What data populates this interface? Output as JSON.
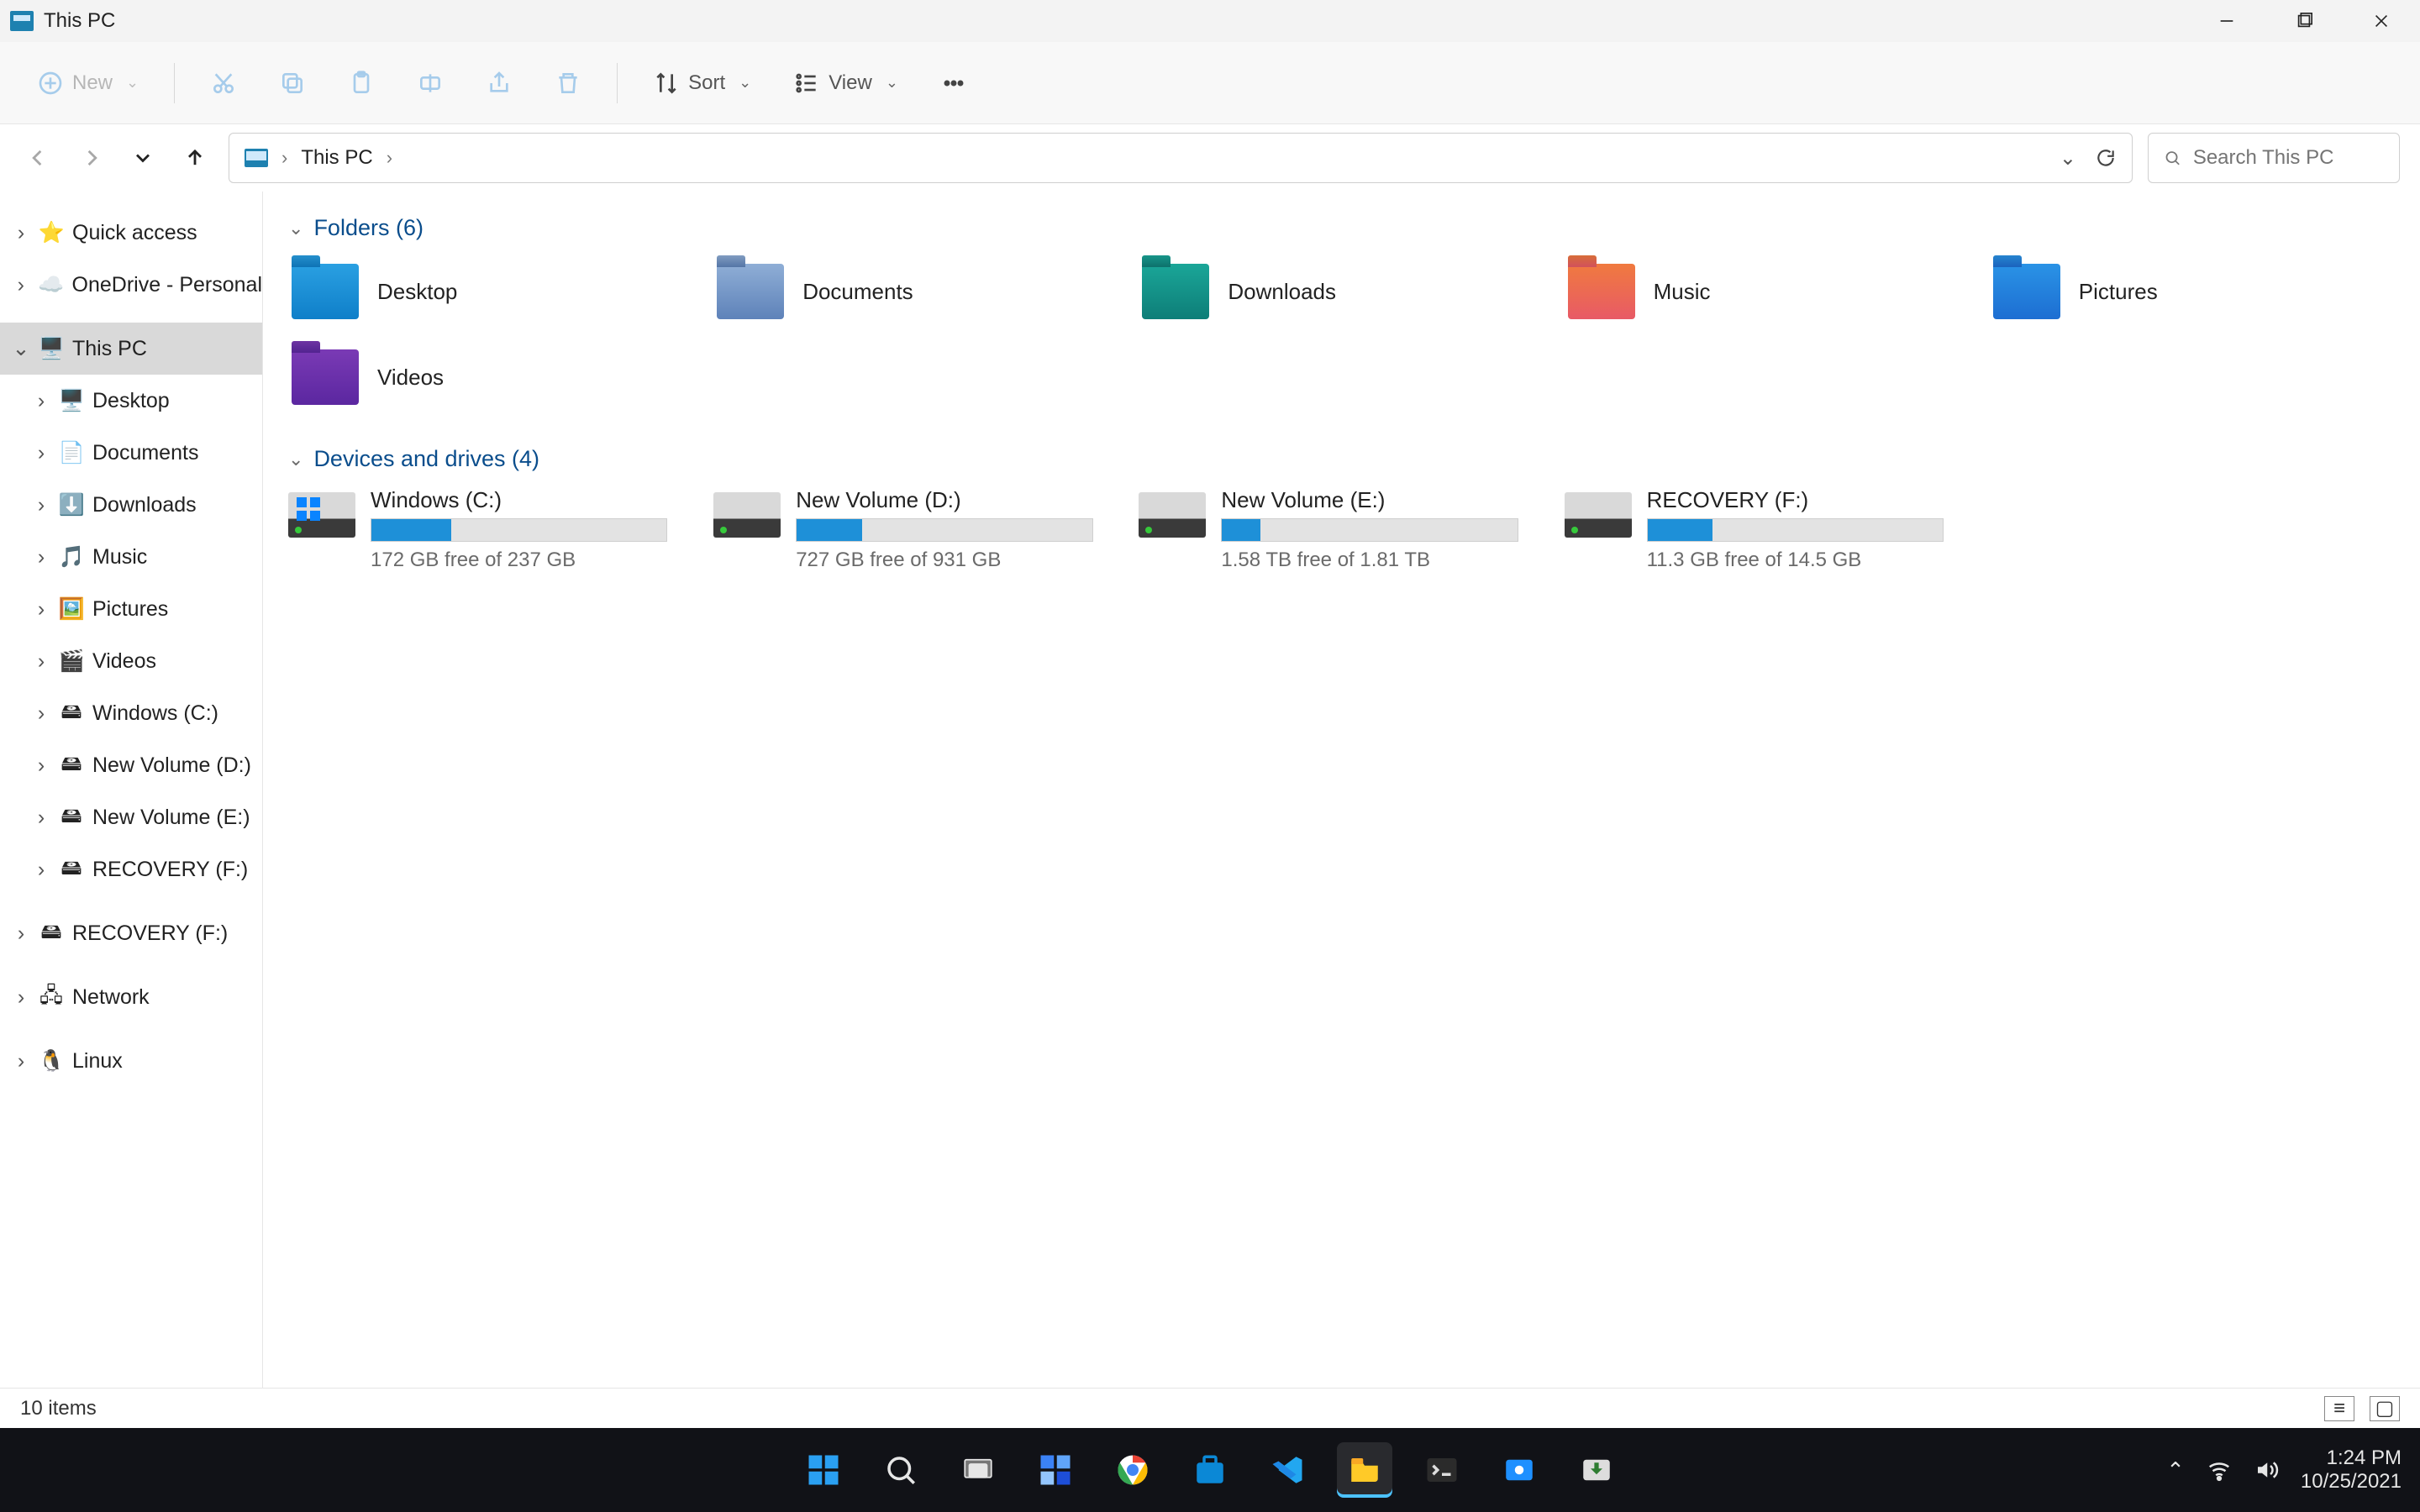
{
  "window": {
    "title": "This PC"
  },
  "toolbar": {
    "new_label": "New",
    "sort_label": "Sort",
    "view_label": "View"
  },
  "address": {
    "crumb1": "This PC"
  },
  "search": {
    "placeholder": "Search This PC"
  },
  "sidebar": {
    "quick_access": "Quick access",
    "onedrive": "OneDrive - Personal",
    "this_pc": "This PC",
    "desktop": "Desktop",
    "documents": "Documents",
    "downloads": "Downloads",
    "music": "Music",
    "pictures": "Pictures",
    "videos": "Videos",
    "windows_c": "Windows (C:)",
    "new_volume_d": "New Volume (D:)",
    "new_volume_e": "New Volume (E:)",
    "recovery_f": "RECOVERY (F:)",
    "recovery_f_root": "RECOVERY (F:)",
    "network": "Network",
    "linux": "Linux"
  },
  "groups": {
    "folders_header": "Folders (6)",
    "drives_header": "Devices and drives (4)"
  },
  "folders": {
    "desktop": "Desktop",
    "documents": "Documents",
    "downloads": "Downloads",
    "music": "Music",
    "pictures": "Pictures",
    "videos": "Videos"
  },
  "drives": {
    "c": {
      "name": "Windows (C:)",
      "free": "172 GB free of 237 GB",
      "fill_pct": 27
    },
    "d": {
      "name": "New Volume (D:)",
      "free": "727 GB free of 931 GB",
      "fill_pct": 22
    },
    "e": {
      "name": "New Volume (E:)",
      "free": "1.58 TB free of 1.81 TB",
      "fill_pct": 13
    },
    "f": {
      "name": "RECOVERY (F:)",
      "free": "11.3 GB free of 14.5 GB",
      "fill_pct": 22
    }
  },
  "status": {
    "items": "10 items"
  },
  "tray": {
    "time": "1:24 PM",
    "date": "10/25/2021"
  }
}
